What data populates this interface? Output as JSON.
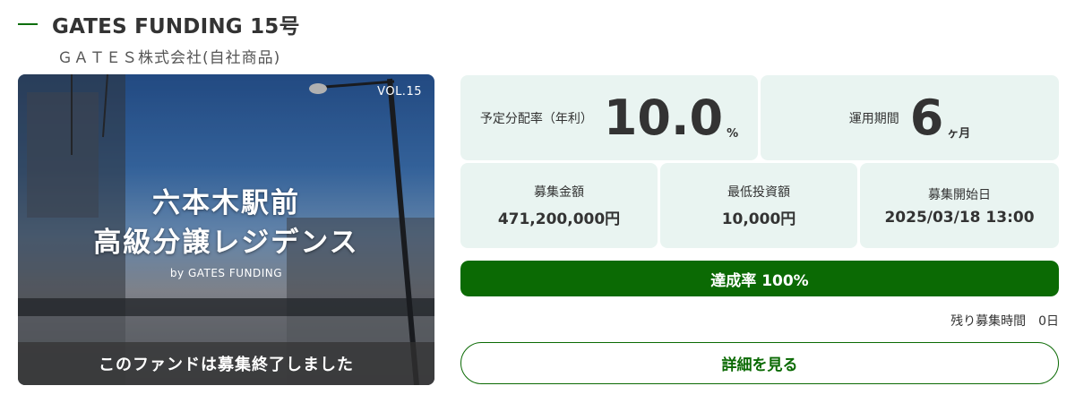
{
  "fund": {
    "title": "GATES FUNDING 15号",
    "company": "ＧＡＴＥＳ株式会社(自社商品)"
  },
  "hero": {
    "vol": "VOL.15",
    "line1": "六本木駅前",
    "line2": "高級分譲レジデンス",
    "by": "by GATES FUNDING",
    "banner": "このファンドは募集終了しました"
  },
  "stats": {
    "rate": {
      "label": "予定分配率（年利）",
      "value": "10.0",
      "unit": "%"
    },
    "term": {
      "label": "運用期間",
      "value": "6",
      "unit": "ヶ月"
    },
    "amount": {
      "label": "募集金額",
      "value": "471,200,000円"
    },
    "min_invest": {
      "label": "最低投資額",
      "value": "10,000円"
    },
    "start": {
      "label": "募集開始日",
      "value": "2025/03/18 13:00"
    }
  },
  "progress": {
    "label": "達成率 100%",
    "percent": 100,
    "color": "#0b6a04"
  },
  "remaining": {
    "label": "残り募集時間",
    "value": "0日"
  },
  "detail_button": {
    "label": "詳細を見る"
  },
  "colors": {
    "accent": "#0b6a04",
    "card_bg": "#e9f4f1"
  }
}
